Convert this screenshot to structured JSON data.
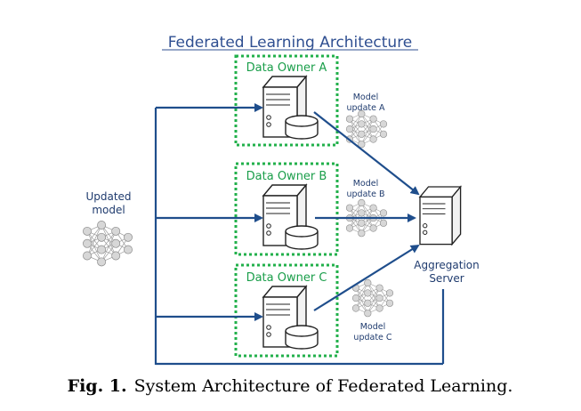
{
  "diagram": {
    "title": "Federated Learning Architecture",
    "owners": [
      {
        "label": "Data Owner A",
        "update_line1": "Model",
        "update_line2": "update A"
      },
      {
        "label": "Data Owner B",
        "update_line1": "Model",
        "update_line2": "update B"
      },
      {
        "label": "Data Owner C",
        "update_line1": "Model",
        "update_line2": "update C"
      }
    ],
    "updated_model": {
      "line1": "Updated",
      "line2": "model"
    },
    "server": {
      "line1": "Aggregation",
      "line2": "Server"
    }
  },
  "caption": {
    "prefix": "Fig. 1.",
    "text": "System Architecture of Federated Learning."
  },
  "colors": {
    "arrow": "#1f4e8c",
    "dashed_box": "#22b04b",
    "title": "#2f4f91"
  }
}
